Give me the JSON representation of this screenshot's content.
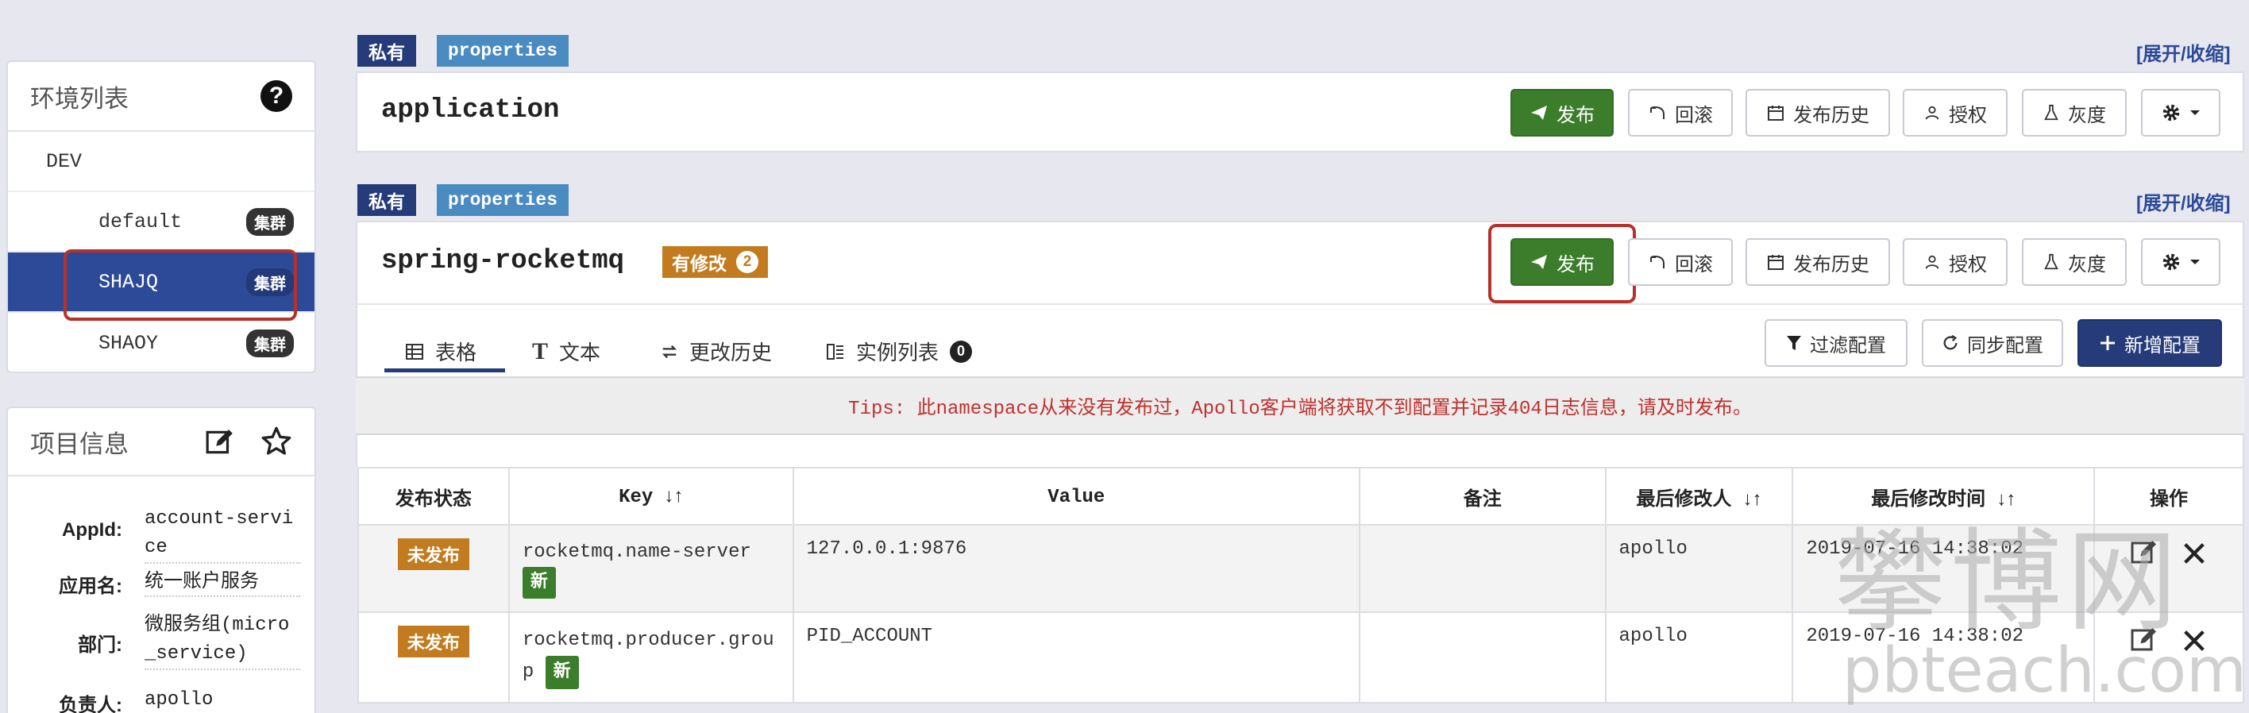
{
  "env_panel": {
    "title": "环境列表",
    "help_icon": "?",
    "env": "DEV",
    "clusters": [
      {
        "name": "default",
        "badge": "集群"
      },
      {
        "name": "SHAJQ",
        "badge": "集群"
      },
      {
        "name": "SHAOY",
        "badge": "集群"
      }
    ]
  },
  "project_panel": {
    "title": "项目信息",
    "rows": [
      {
        "key": "AppId:",
        "value": "account-service"
      },
      {
        "key": "应用名:",
        "value": "统一账户服务"
      },
      {
        "key": "部门:",
        "value": "微服务组(micro_service)"
      },
      {
        "key": "负责人:",
        "value": "apollo"
      }
    ]
  },
  "namespace1": {
    "private_tag": "私有",
    "format_tag": "properties",
    "expand": "[展开/收缩]",
    "name": "application",
    "buttons": {
      "publish": "发布",
      "rollback": "回滚",
      "history": "发布历史",
      "auth": "授权",
      "gray": "灰度"
    }
  },
  "namespace2": {
    "private_tag": "私有",
    "format_tag": "properties",
    "expand": "[展开/收缩]",
    "name": "spring-rocketmq",
    "modified_label": "有修改",
    "modified_count": "2",
    "buttons": {
      "publish": "发布",
      "rollback": "回滚",
      "history": "发布历史",
      "auth": "授权",
      "gray": "灰度"
    },
    "tabs": [
      {
        "label": "表格"
      },
      {
        "label": "文本"
      },
      {
        "label": "更改历史"
      },
      {
        "label": "实例列表",
        "count": "0"
      }
    ],
    "actions": {
      "filter": "过滤配置",
      "sync": "同步配置",
      "add": "新增配置"
    },
    "tips": "Tips: 此namespace从来没有发布过，Apollo客户端将获取不到配置并记录404日志信息，请及时发布。",
    "table": {
      "headers": [
        "发布状态",
        "Key",
        "Value",
        "备注",
        "最后修改人",
        "最后修改时间",
        "操作"
      ],
      "rows": [
        {
          "status": "未发布",
          "key": "rocketmq.name-server",
          "new": "新",
          "value": "127.0.0.1:9876",
          "comment": "",
          "modifier": "apollo",
          "time": "2019-07-16 14:38:02"
        },
        {
          "status": "未发布",
          "key": "rocketmq.producer.group",
          "new": "新",
          "value": "PID_ACCOUNT",
          "comment": "",
          "modifier": "apollo",
          "time": "2019-07-16 14:38:02"
        }
      ]
    }
  },
  "watermark": {
    "cn": "攀博网",
    "en": "pbteach.com"
  }
}
